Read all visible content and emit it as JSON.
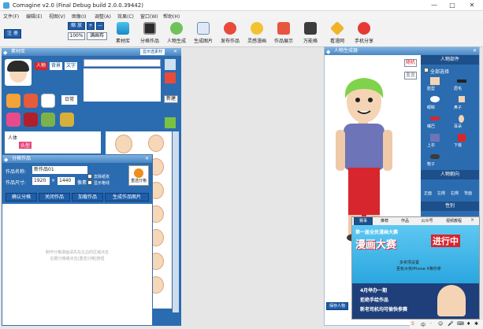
{
  "window": {
    "title": "Comagine v2.0 (Final Debug build 2.0.0.39442)",
    "min": "—",
    "max": "□",
    "close": "✕"
  },
  "menu": [
    "文件(F)",
    "编辑(E)",
    "视图(V)",
    "图像(I)",
    "调整(A)",
    "效果(C)",
    "窗口(W)",
    "帮助(H)"
  ],
  "toolbar": {
    "login": "注 册",
    "zoom_in": "缩 放",
    "zoom_plus": "+",
    "zoom_minus": "—",
    "zoom_value": "100%",
    "fit_window": "满画布",
    "tools": [
      "素材库",
      "分格作品",
      "人物生成",
      "生成图片",
      "发布作品",
      "灵感漫画",
      "作品展示",
      "万能格",
      "看漫网",
      "手机分享"
    ]
  },
  "material": {
    "title": "素材库",
    "tab_selected": "显示选素材",
    "tabs": [
      "人物",
      "背景",
      "文字"
    ],
    "side_btns": [
      "日常"
    ],
    "right_btn": "新建",
    "tree": {
      "root": "人体",
      "child": "头型"
    }
  },
  "panel_grid": {
    "title": "分格作品",
    "name_label": "作品名称:",
    "name_value": "新作品01",
    "size_label": "作品尺寸:",
    "width": "1920",
    "height": "1440",
    "unit": "像素",
    "check1": "去除纸张",
    "check2": "显示格线",
    "auto_label": "重选分格",
    "buttons": [
      "确认分格",
      "关闭作品",
      "加载作品",
      "生成作品图片"
    ],
    "hint_line1": "制作分格漫画请先在左边的区域点击",
    "hint_line2": "右键分格或点击[重选分格]按钮"
  },
  "character": {
    "title": "人物生成器",
    "btn_random": "随机",
    "btn_reset": "重置",
    "parts_title": "人物部件",
    "select_all": "全部选择",
    "parts": [
      "脸型",
      "眉毛",
      "眼睛",
      "鼻子",
      "嘴巴",
      "耳朵",
      "上衣",
      "下装",
      "鞋子"
    ],
    "orientation_title": "人物朝向",
    "orientations": [
      "正面",
      "左侧",
      "右侧",
      "背面"
    ],
    "gender_title": "性别",
    "save_btn": "保存人物"
  },
  "news": {
    "tabs": [
      "赛事",
      "推荐",
      "作品",
      "公众号",
      "视频教程"
    ],
    "banner_top": "第一届全民漫画大赛",
    "banner_big": "漫画大赛",
    "banner_right": "进行中",
    "banner_line1": "多奖项设置",
    "banner_line2": "更有大奖iPhone X等你拿",
    "bottom1": "4月举办一期",
    "bottom2": "拒绝手绘作品",
    "bottom3": "新老司机均可偷快参赛"
  },
  "tray": {
    "items": [
      "S",
      "中",
      "·",
      "☺",
      "🎤",
      "⌨",
      "♦",
      "✱"
    ]
  },
  "colors": {
    "accent": "#1f5da8",
    "panel": "#2b6cb0",
    "header": "#5f9bd3"
  }
}
